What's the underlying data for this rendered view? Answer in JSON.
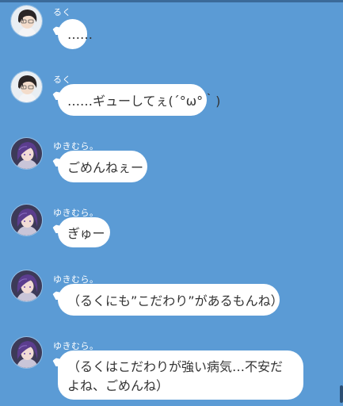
{
  "messages": [
    {
      "sender": "るく",
      "avatar": "male-avatar",
      "text": "……"
    },
    {
      "sender": "るく",
      "avatar": "male-avatar",
      "text": "……ギューしてぇ(´°ω°｀)"
    },
    {
      "sender": "ゆきむら。",
      "avatar": "female-avatar",
      "text": "ごめんねぇー"
    },
    {
      "sender": "ゆきむら。",
      "avatar": "female-avatar",
      "text": "ぎゅー"
    },
    {
      "sender": "ゆきむら。",
      "avatar": "female-avatar",
      "text": "（るくにも”こだわり”があるもんね）"
    },
    {
      "sender": "ゆきむら。",
      "avatar": "female-avatar",
      "text": "（るくはこだわりが強い病気…不安だよね、ごめんね）"
    }
  ],
  "colors": {
    "background": "#5b9bd5",
    "bubble": "#ffffff",
    "bubble_text": "#333333",
    "sender_text": "#ffffff"
  }
}
